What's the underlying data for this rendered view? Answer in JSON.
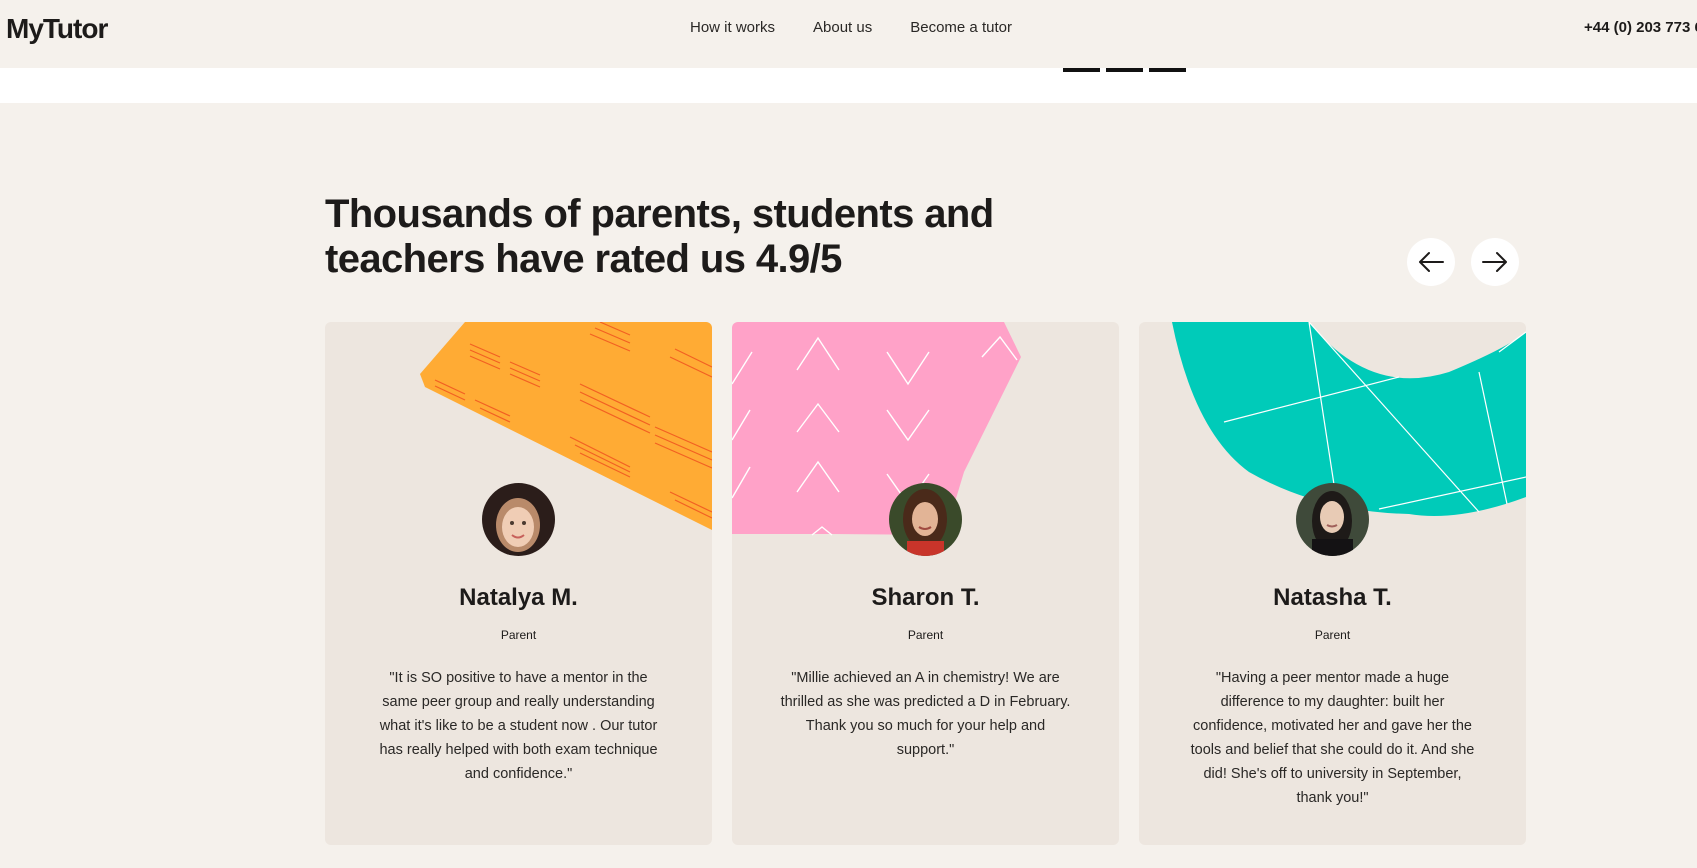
{
  "header": {
    "logo": "MyTutor",
    "nav": [
      "How it works",
      "About us",
      "Become a tutor"
    ],
    "phone": "+44 (0) 203 773 6"
  },
  "section": {
    "heading_line1": "Thousands of parents, students and",
    "heading_line2": "teachers have rated us 4.9/5",
    "prev_icon": "arrow-left-icon",
    "next_icon": "arrow-right-icon"
  },
  "colors": {
    "background": "#f5f1ec",
    "card": "#ede6df",
    "orange": "#ffab34",
    "pink": "#ffa2c8",
    "teal": "#00cbb9"
  },
  "testimonials": [
    {
      "name": "Natalya M.",
      "role": "Parent",
      "quote": "\"It is SO positive to have a mentor in the same peer group and really understanding what it's like to be a student now . Our tutor has really helped with both exam technique and confidence.\""
    },
    {
      "name": "Sharon T.",
      "role": "Parent",
      "quote": "\"Millie achieved an A in chemistry! We are thrilled as she was predicted a D in February. Thank you so much for your help and support.\""
    },
    {
      "name": "Natasha T.",
      "role": "Parent",
      "quote": "\"Having a peer mentor made a huge difference to my daughter: built her confidence, motivated her and gave her the tools and belief that she could do it. And she did! She's off to university in September, thank you!\""
    }
  ]
}
